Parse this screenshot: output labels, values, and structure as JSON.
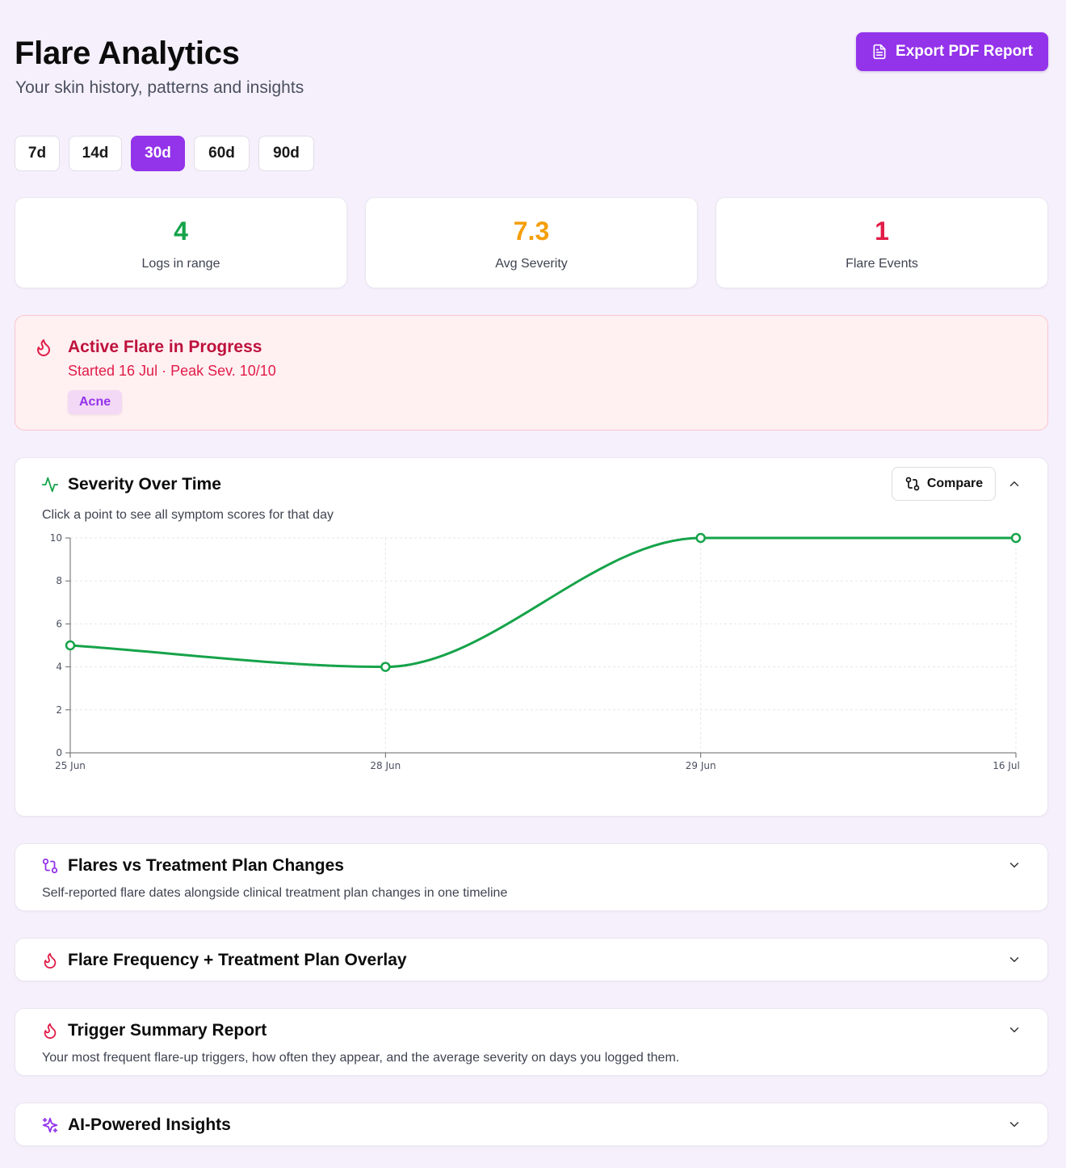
{
  "header": {
    "title": "Flare Analytics",
    "subtitle": "Your skin history, patterns and insights",
    "export_label": "Export PDF Report"
  },
  "ranges": [
    {
      "label": "7d",
      "active": false
    },
    {
      "label": "14d",
      "active": false
    },
    {
      "label": "30d",
      "active": true
    },
    {
      "label": "60d",
      "active": false
    },
    {
      "label": "90d",
      "active": false
    }
  ],
  "stats": [
    {
      "value": "4",
      "label": "Logs in range",
      "color": "#16a34a"
    },
    {
      "value": "7.3",
      "label": "Avg Severity",
      "color": "#f59e0b"
    },
    {
      "value": "1",
      "label": "Flare Events",
      "color": "#e11d48"
    }
  ],
  "active_flare": {
    "title": "Active Flare in Progress",
    "subtitle": "Started 16 Jul · Peak Sev. 10/10",
    "tag": "Acne"
  },
  "severity_card": {
    "title": "Severity Over Time",
    "compare_label": "Compare",
    "hint": "Click a point to see all symptom scores for that day"
  },
  "chart_data": {
    "type": "line",
    "categories": [
      "25 Jun",
      "28 Jun",
      "29 Jun",
      "16 Jul"
    ],
    "values": [
      5,
      4,
      10,
      10
    ],
    "ylim": [
      0,
      10
    ],
    "yticks": [
      0,
      2,
      4,
      6,
      8,
      10
    ],
    "grid": true,
    "color": "#16a34a"
  },
  "sections": [
    {
      "title": "Flares vs Treatment Plan Changes",
      "description": "Self-reported flare dates alongside clinical treatment plan changes in one timeline",
      "icon": "git-compare-icon"
    },
    {
      "title": "Flare Frequency + Treatment Plan Overlay",
      "description": "",
      "icon": "flame-icon"
    },
    {
      "title": "Trigger Summary Report",
      "description": "Your most frequent flare-up triggers, how often they appear, and the average severity on days you logged them.",
      "icon": "flame-icon"
    },
    {
      "title": "AI-Powered Insights",
      "description": "",
      "icon": "sparkles-icon"
    }
  ],
  "colors": {
    "accent": "#9333ea",
    "flare": "#e11d48",
    "success": "#16a34a"
  }
}
